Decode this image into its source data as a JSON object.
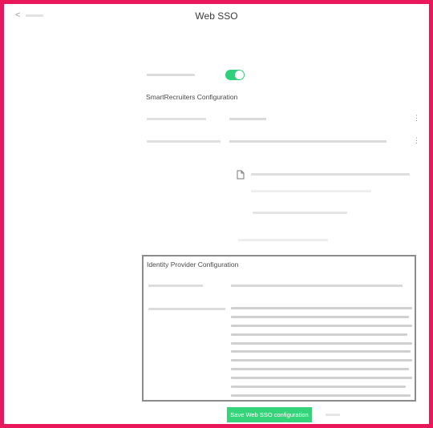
{
  "header": {
    "back_label": "< ",
    "title": "Web SSO"
  },
  "sections": {
    "smartrecruiters": "SmartRecruiters Configuration",
    "identity_provider": "Identity Provider Configuration"
  },
  "actions": {
    "save_label": "Save Web SSO configuration"
  },
  "colors": {
    "accent": "#2fd07a",
    "frame": "#e8185a"
  }
}
